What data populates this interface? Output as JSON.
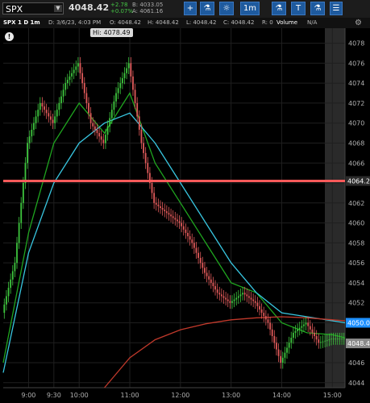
{
  "toolbar": {
    "symbol": "SPX",
    "last_price": "4048.42",
    "change": "+2.78",
    "change_pct": "+0.07%",
    "bid": "B: 4033.05",
    "ask": "A: 4061.16",
    "buttons": [
      {
        "name": "crosshair-button",
        "icon": "crosshair-icon",
        "glyph": "+"
      },
      {
        "name": "studies-button",
        "icon": "flask-icon",
        "glyph": "⚗"
      },
      {
        "name": "drawing-style-button",
        "icon": "sun-icon",
        "glyph": "☼"
      },
      {
        "name": "timeframe-button",
        "icon": "",
        "glyph": "1m"
      },
      {
        "name": "drawings-button",
        "icon": "flask-icon",
        "glyph": "⚗"
      },
      {
        "name": "text-tool-button",
        "icon": "text-icon",
        "glyph": "T"
      },
      {
        "name": "studies-2-button",
        "icon": "flask-icon",
        "glyph": "⚗"
      },
      {
        "name": "menu-button",
        "icon": "menu-icon",
        "glyph": "☰"
      }
    ]
  },
  "infobar": {
    "symbol": "SPX 1 D 1m",
    "date": "D: 3/6/23, 4:03 PM",
    "open": "O: 4048.42",
    "high": "H: 4048.42",
    "low": "L: 4048.42",
    "close": "C: 4048.42",
    "range": "R: 0",
    "volume_label": "Volume",
    "volume_value": "N/A"
  },
  "chart_header": {
    "hi_label": "Hi: 4078.49"
  },
  "chart_data": {
    "type": "line",
    "title": "",
    "symbol": "SPX",
    "interval": "1m",
    "xlabel": "",
    "ylabel": "",
    "x_ticks": [
      "9:00",
      "9:30",
      "10:00",
      "11:00",
      "12:00",
      "13:00",
      "14:00",
      "15:00"
    ],
    "y_ticks": [
      4078,
      4076,
      4074,
      4072,
      4070,
      4068,
      4066,
      4064,
      4062,
      4060,
      4058,
      4056,
      4054,
      4052,
      4050,
      4048,
      4046,
      4044
    ],
    "ylim": [
      4043.5,
      4079.5
    ],
    "grid": true,
    "horizontal_level": {
      "value": 4064.2,
      "label": "4064.2",
      "color": "#ff5a5a"
    },
    "price_labels": [
      {
        "value": 4050.0,
        "label": "4050.0",
        "color": "#1e90ff"
      },
      {
        "value": 4048.42,
        "label": "4048.4",
        "color": "#8a8a8a"
      }
    ],
    "series": [
      {
        "name": "",
        "color": "#3ec63e",
        "x": [
          "8:30",
          "8:45",
          "9:00",
          "9:15",
          "9:30",
          "9:45",
          "10:00",
          "10:15",
          "10:30",
          "10:45",
          "11:00",
          "11:15",
          "11:30",
          "11:45",
          "12:00",
          "12:15",
          "12:30",
          "12:45",
          "13:00",
          "13:15",
          "13:30",
          "13:45",
          "14:00",
          "14:15",
          "14:30",
          "14:45",
          "15:00",
          "15:15"
        ],
        "y": [
          4051,
          4056,
          4068,
          4072,
          4070,
          4074,
          4076,
          4070,
          4068,
          4073,
          4076,
          4068,
          4062,
          4061,
          4060,
          4058,
          4055,
          4053,
          4052,
          4053,
          4052,
          4050,
          4046,
          4049,
          4050,
          4048,
          4048.4,
          4048.4
        ]
      },
      {
        "name": "",
        "color": "#1fa51f",
        "x": [
          "8:30",
          "9:00",
          "9:30",
          "10:00",
          "10:30",
          "11:00",
          "11:30",
          "12:00",
          "12:30",
          "13:00",
          "13:30",
          "14:00",
          "14:30",
          "15:00",
          "15:15"
        ],
        "y": [
          4046,
          4059,
          4068,
          4072,
          4069,
          4073,
          4066,
          4062,
          4058,
          4054,
          4053,
          4050,
          4049,
          4048.8,
          4048.5
        ]
      },
      {
        "name": "",
        "color": "#38c6e0",
        "x": [
          "8:30",
          "9:00",
          "9:30",
          "10:00",
          "10:30",
          "11:00",
          "11:30",
          "12:00",
          "12:30",
          "13:00",
          "13:30",
          "14:00",
          "14:30",
          "15:00",
          "15:15"
        ],
        "y": [
          4045,
          4057,
          4064,
          4068,
          4070,
          4071,
          4068,
          4064,
          4060,
          4056,
          4053,
          4051,
          4050.6,
          4050.2,
          4050.0
        ]
      },
      {
        "name": "",
        "color": "#c0392b",
        "x": [
          "10:30",
          "11:00",
          "11:30",
          "12:00",
          "12:30",
          "13:00",
          "13:30",
          "14:00",
          "14:30",
          "15:00",
          "15:15"
        ],
        "y": [
          4043.5,
          4046.5,
          4048.3,
          4049.3,
          4049.9,
          4050.3,
          4050.5,
          4050.6,
          4050.5,
          4050.3,
          4050.2
        ]
      }
    ]
  },
  "colors": {
    "background": "#000000",
    "grid": "#1f1f1f",
    "level_line": "#ff5a5a",
    "toolbar_button": "#1e5a9e"
  }
}
